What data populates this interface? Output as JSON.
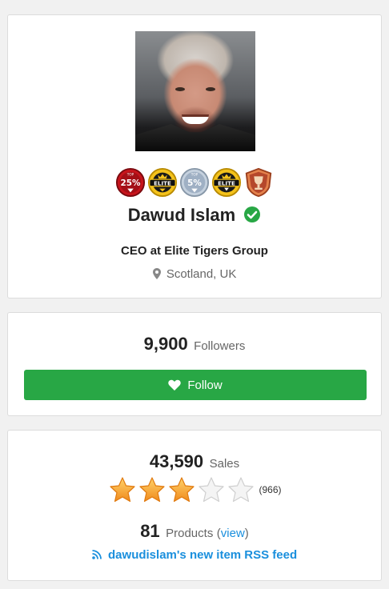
{
  "profile": {
    "name": "Dawud Islam",
    "title": "CEO at Elite Tigers Group",
    "location": "Scotland, UK",
    "verified_icon": "verified-check-icon",
    "badges": [
      {
        "icon": "top-25-percent-badge",
        "label": "25%",
        "small": "TOP",
        "color": "#c8141c"
      },
      {
        "icon": "elite-badge",
        "label": "ELITE",
        "color": "#1a1a1a"
      },
      {
        "icon": "top-5-percent-badge",
        "label": "5%",
        "small": "TOP",
        "color": "#9fb0c4"
      },
      {
        "icon": "elite-author-badge",
        "label": "ELITE",
        "color": "#1a1a1a"
      },
      {
        "icon": "trophy-badge",
        "label": "",
        "color": "#b5482b"
      }
    ]
  },
  "followers": {
    "count": "9,900",
    "label": "Followers",
    "button_label": "Follow",
    "button_color": "#28a745"
  },
  "sales": {
    "count": "43,590",
    "label": "Sales",
    "rating": 3,
    "rating_max": 5,
    "review_count": "(966)"
  },
  "products": {
    "count": "81",
    "label": "Products",
    "open_paren": "(",
    "view_label": "view",
    "close_paren": ")"
  },
  "rss": {
    "label": "dawudislam's new item RSS feed",
    "link_color": "#1a8fdd"
  }
}
